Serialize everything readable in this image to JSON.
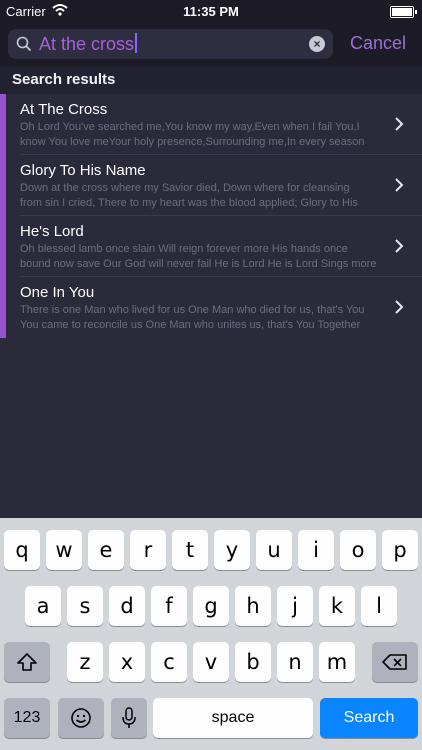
{
  "status_bar": {
    "carrier": "Carrier",
    "time": "11:35 PM"
  },
  "search": {
    "query": "At the cross",
    "cancel_label": "Cancel"
  },
  "section_header": "Search results",
  "results": [
    {
      "title": "At The Cross",
      "line1": "Oh Lord You've searched me,You know my way,Even when I fail You,I",
      "line2": "know You love meYour holy presence,Surrounding me,In every season"
    },
    {
      "title": "Glory To His Name",
      "line1": "Down at the cross where my Savior died, Down where for cleansing",
      "line2": "from sin I cried, There to my heart was the blood applied; Glory to His"
    },
    {
      "title": "He's Lord",
      "line1": "Oh blessed lamb once slain Will reign forever more His hands once",
      "line2": "bound now save Our God will never fail He is Lord He is Lord Sings more"
    },
    {
      "title": "One In You",
      "line1": "There is one Man who lived for us One Man who died for us, that's You",
      "line2": "You came to reconcile us One Man who unites us, that's You Together"
    }
  ],
  "keyboard": {
    "row1": [
      "q",
      "w",
      "e",
      "r",
      "t",
      "y",
      "u",
      "i",
      "o",
      "p"
    ],
    "row2": [
      "a",
      "s",
      "d",
      "f",
      "g",
      "h",
      "j",
      "k",
      "l"
    ],
    "row3": [
      "z",
      "x",
      "c",
      "v",
      "b",
      "n",
      "m"
    ],
    "numbers_label": "123",
    "space_label": "space",
    "search_label": "Search"
  },
  "colors": {
    "accent": "#9b4fd1",
    "query_text": "#a85fdc",
    "search_key": "#0a84ff"
  }
}
